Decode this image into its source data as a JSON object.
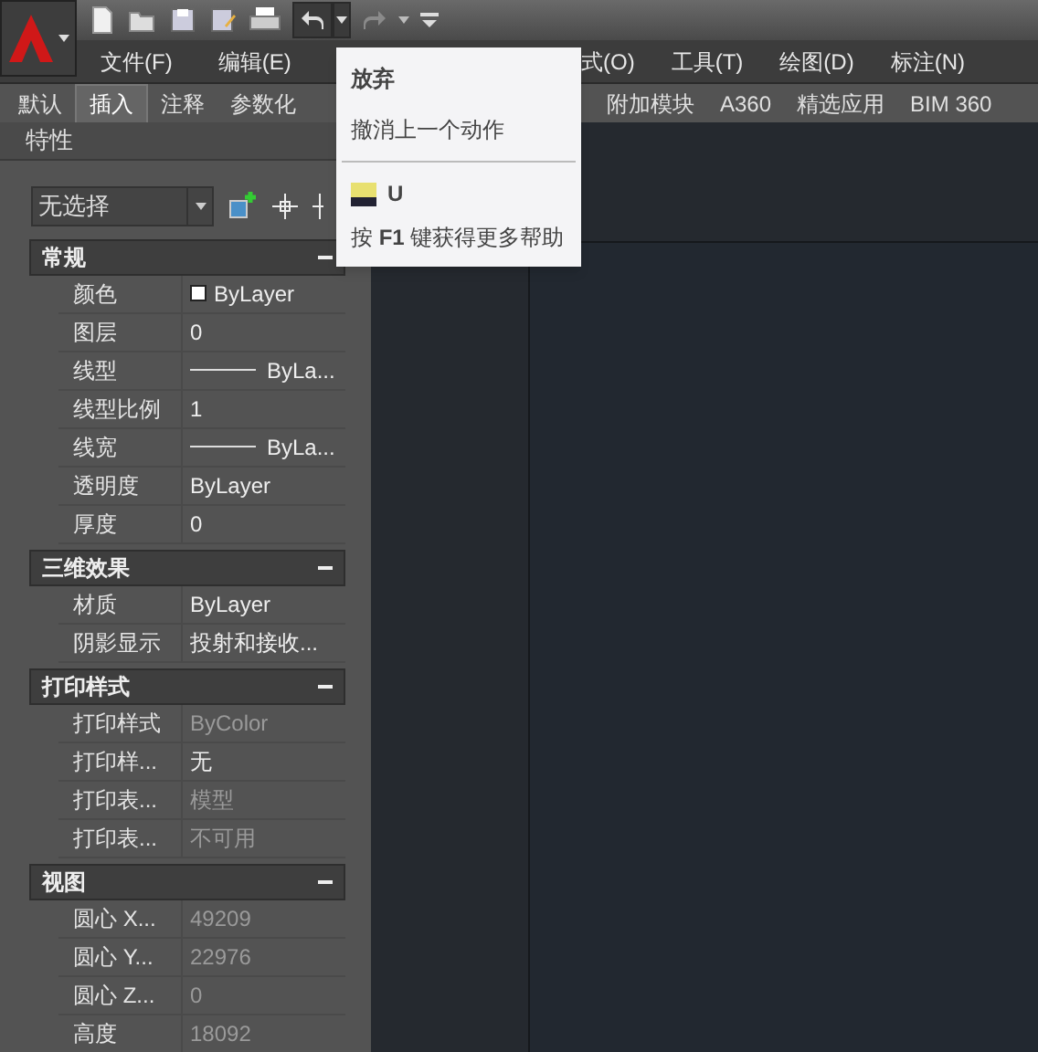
{
  "menu": [
    {
      "label": "文件(F)"
    },
    {
      "label": "编辑(E)"
    },
    {
      "label": "式(O)"
    },
    {
      "label": "工具(T)"
    },
    {
      "label": "绘图(D)"
    },
    {
      "label": "标注(N)"
    }
  ],
  "ribbon_tabs_left": [
    {
      "label": "默认",
      "selected": false
    },
    {
      "label": "插入",
      "selected": true
    },
    {
      "label": "注释",
      "selected": false
    },
    {
      "label": "参数化",
      "selected": false
    }
  ],
  "ribbon_tabs_right": [
    {
      "label": "附加模块",
      "selected": false
    },
    {
      "label": "A360",
      "selected": false
    },
    {
      "label": "精选应用",
      "selected": false
    },
    {
      "label": "BIM 360",
      "selected": false
    }
  ],
  "tooltip": {
    "title": "放弃",
    "description": "撤消上一个动作",
    "command": "U",
    "help": "按 **F1** 键获得更多帮助"
  },
  "palette": {
    "title": "特性",
    "selection": "无选择",
    "sections": [
      {
        "title": "常规",
        "expanded": true,
        "rows": [
          {
            "kind": "color",
            "label": "颜色",
            "value": "ByLayer",
            "disabled": false
          },
          {
            "kind": "text",
            "label": "图层",
            "value": "0",
            "disabled": false
          },
          {
            "kind": "line",
            "label": "线型",
            "value": "ByLa...",
            "disabled": false
          },
          {
            "kind": "text",
            "label": "线型比例",
            "value": "1",
            "disabled": false
          },
          {
            "kind": "line",
            "label": "线宽",
            "value": "ByLa...",
            "disabled": false
          },
          {
            "kind": "text",
            "label": "透明度",
            "value": "ByLayer",
            "disabled": false
          },
          {
            "kind": "text",
            "label": "厚度",
            "value": "0",
            "disabled": false
          }
        ]
      },
      {
        "title": "三维效果",
        "expanded": true,
        "rows": [
          {
            "kind": "text",
            "label": "材质",
            "value": "ByLayer",
            "disabled": false
          },
          {
            "kind": "text",
            "label": "阴影显示",
            "value": "投射和接收...",
            "disabled": false
          }
        ]
      },
      {
        "title": "打印样式",
        "expanded": true,
        "rows": [
          {
            "kind": "text",
            "label": "打印样式",
            "value": "ByColor",
            "disabled": true
          },
          {
            "kind": "text",
            "label": "打印样...",
            "value": "无",
            "disabled": false
          },
          {
            "kind": "text",
            "label": "打印表...",
            "value": "模型",
            "disabled": true
          },
          {
            "kind": "text",
            "label": "打印表...",
            "value": "不可用",
            "disabled": true
          }
        ]
      },
      {
        "title": "视图",
        "expanded": true,
        "rows": [
          {
            "kind": "text",
            "label": "圆心 X...",
            "value": "49209",
            "disabled": true
          },
          {
            "kind": "text",
            "label": "圆心 Y...",
            "value": "22976",
            "disabled": true
          },
          {
            "kind": "text",
            "label": "圆心 Z...",
            "value": "0",
            "disabled": true
          },
          {
            "kind": "text",
            "label": "高度",
            "value": "18092",
            "disabled": true
          }
        ]
      }
    ]
  }
}
